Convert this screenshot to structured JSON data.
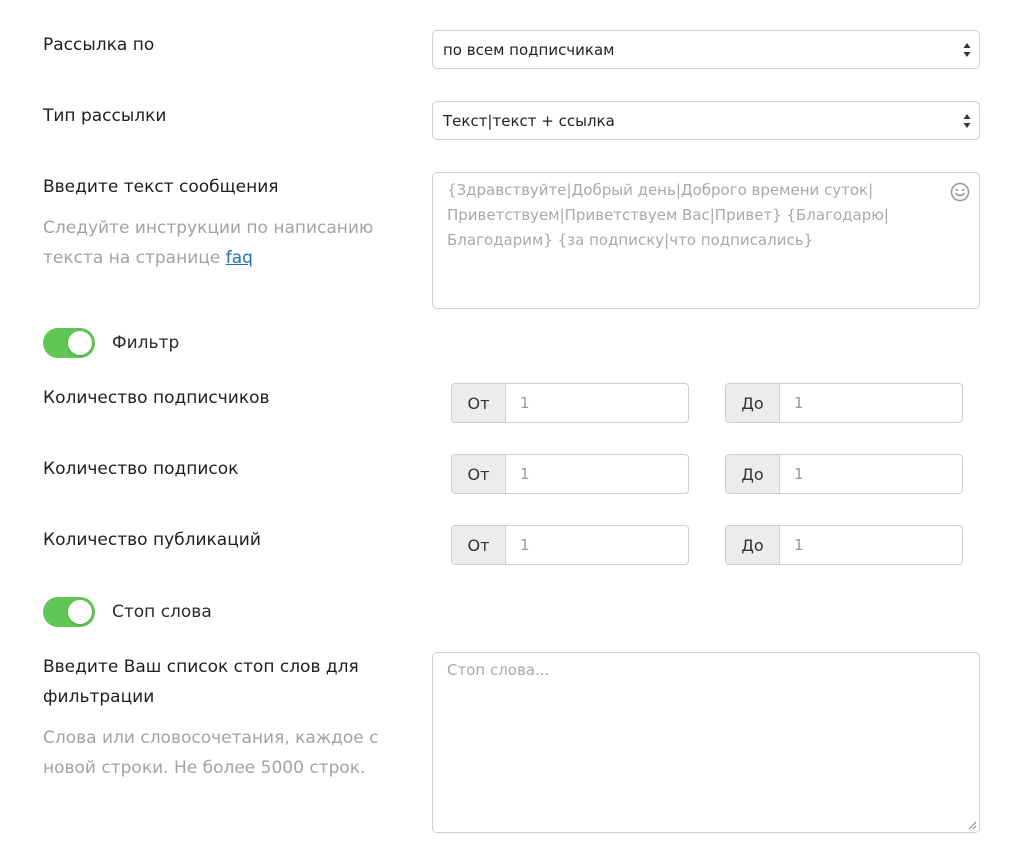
{
  "mailing": {
    "label": "Рассылка по",
    "value": "по всем подписчикам"
  },
  "mailing_type": {
    "label": "Тип рассылки",
    "value": "Текст|текст + ссылка"
  },
  "message": {
    "label": "Введите текст сообщения",
    "hint_before": "Следуйте инструкции по написанию текста на странице ",
    "hint_link": "faq",
    "placeholder_lines": [
      "{Здравствуйте|Добрый день|Доброго времени суток|",
      "Приветствуем|Приветствуем Вас|Привет} {Благодарю|",
      "Благодарим} {за подписку|что подписались}"
    ]
  },
  "filter": {
    "label": "Фильтр",
    "enabled": true
  },
  "ranges": [
    {
      "label": "Количество подписчиков",
      "from_label": "От",
      "from_value": "1",
      "to_label": "До",
      "to_value": "1"
    },
    {
      "label": "Количество подписок",
      "from_label": "От",
      "from_value": "1",
      "to_label": "До",
      "to_value": "1"
    },
    {
      "label": "Количество публикаций",
      "from_label": "От",
      "from_value": "1",
      "to_label": "До",
      "to_value": "1"
    }
  ],
  "stopwords_toggle": {
    "label": "Стоп слова",
    "enabled": true
  },
  "stopwords": {
    "label_line1": "Введите Ваш список стоп слов для",
    "label_line2": "фильтрации",
    "hint_line1": "Слова или словосочетания, каждое с",
    "hint_line2": "новой строки. Не более 5000 строк.",
    "placeholder": "Стоп слова..."
  },
  "colors": {
    "toggle_on": "#61c655",
    "link": "#2a6ab8"
  },
  "icons": {
    "select_arrows": "sort-arrows-icon",
    "emoji": "smile-icon",
    "resize": "resize-handle-icon"
  }
}
